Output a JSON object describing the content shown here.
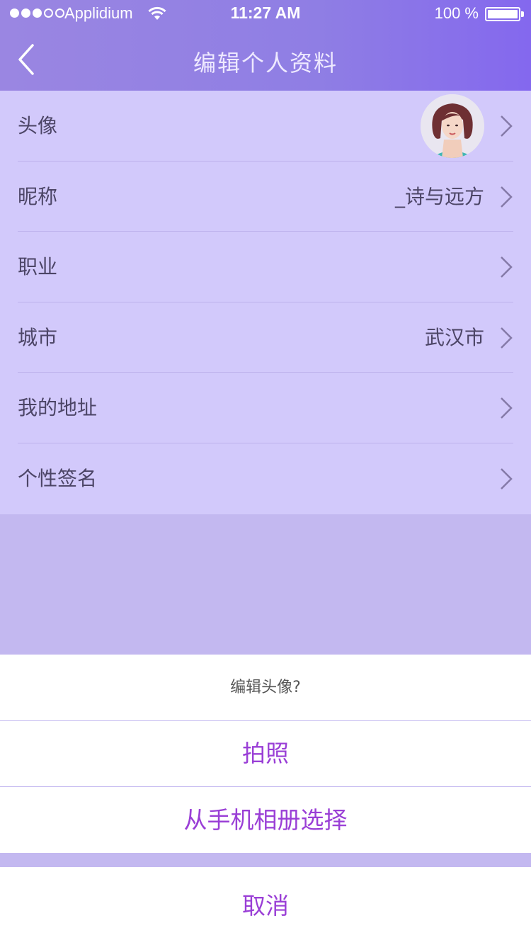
{
  "status_bar": {
    "carrier": "Applidium",
    "time": "11:27 AM",
    "battery": "100 %",
    "icons": [
      "signal-dots-icon",
      "wifi-icon",
      "battery-icon"
    ]
  },
  "nav": {
    "title": "编辑个人资料",
    "back_icon": "chevron-left-icon"
  },
  "profile_rows": [
    {
      "label": "头像",
      "value": ""
    },
    {
      "label": "昵称",
      "value": "_诗与远方"
    },
    {
      "label": "职业",
      "value": ""
    },
    {
      "label": "城市",
      "value": "武汉市"
    },
    {
      "label": "我的地址",
      "value": ""
    },
    {
      "label": "个性签名",
      "value": ""
    }
  ],
  "action_sheet": {
    "title": "编辑头像?",
    "take_photo": "拍照",
    "choose_album": "从手机相册选择",
    "cancel": "取消"
  },
  "colors": {
    "nav_gradient_start": "#9a86e2",
    "nav_gradient_end": "#8468ee",
    "list_bg": "#d2c9fb",
    "overlay_bg": "#c3b8f0",
    "accent": "#9a3fd6",
    "text": "#4c4566"
  }
}
